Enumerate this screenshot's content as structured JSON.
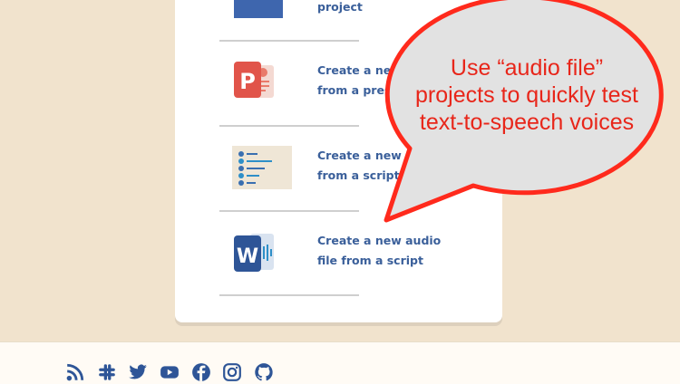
{
  "card": {
    "items": [
      {
        "label": "project",
        "icon": "blank-project-icon"
      },
      {
        "label": "Create a new\nfrom a pres",
        "icon": "powerpoint-icon"
      },
      {
        "label": "Create a new\nfrom a script",
        "icon": "script-icon"
      },
      {
        "label": "Create a new audio\nfile from a script",
        "icon": "word-audio-icon"
      }
    ]
  },
  "callout": {
    "text": "Use “audio file” projects to quickly test text-to-speech voices",
    "border_color": "#ff2a1c",
    "fill_color": "#e2e2e2",
    "text_color": "#e8261a"
  },
  "footer": {
    "social_icons": [
      "rss-icon",
      "slack-icon",
      "twitter-icon",
      "youtube-icon",
      "facebook-icon",
      "instagram-icon",
      "github-icon"
    ]
  },
  "colors": {
    "background": "#f1e3cd",
    "link": "#3a5f9a",
    "icon_blue": "#2e5597"
  }
}
